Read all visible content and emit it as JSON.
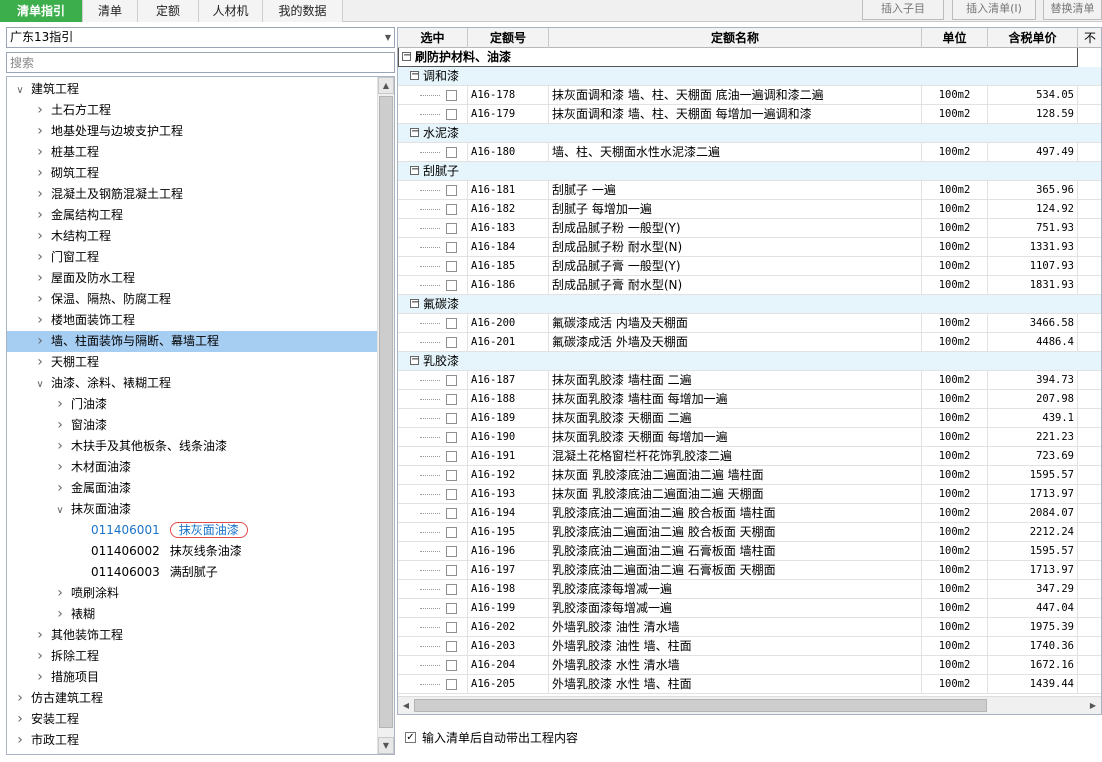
{
  "topbar": {
    "tabs": [
      {
        "label": "清单指引",
        "active": true
      },
      {
        "label": "清单",
        "active": false
      },
      {
        "label": "定额",
        "active": false
      },
      {
        "label": "人材机",
        "active": false
      },
      {
        "label": "我的数据",
        "active": false
      }
    ],
    "buttons": {
      "insert_child": "插入子目",
      "insert_list": "插入清单(I)",
      "replace_list": "替换清单"
    }
  },
  "left": {
    "guide_select": "广东13指引",
    "search_placeholder": "搜索",
    "tree": [
      {
        "label": "建筑工程",
        "level": 0,
        "toggle": "expanded"
      },
      {
        "label": "土石方工程",
        "level": 1,
        "toggle": "collapsed"
      },
      {
        "label": "地基处理与边坡支护工程",
        "level": 1,
        "toggle": "collapsed"
      },
      {
        "label": "桩基工程",
        "level": 1,
        "toggle": "collapsed"
      },
      {
        "label": "砌筑工程",
        "level": 1,
        "toggle": "collapsed"
      },
      {
        "label": "混凝土及钢筋混凝土工程",
        "level": 1,
        "toggle": "collapsed"
      },
      {
        "label": "金属结构工程",
        "level": 1,
        "toggle": "collapsed"
      },
      {
        "label": "木结构工程",
        "level": 1,
        "toggle": "collapsed"
      },
      {
        "label": "门窗工程",
        "level": 1,
        "toggle": "collapsed"
      },
      {
        "label": "屋面及防水工程",
        "level": 1,
        "toggle": "collapsed"
      },
      {
        "label": "保温、隔热、防腐工程",
        "level": 1,
        "toggle": "collapsed"
      },
      {
        "label": "楼地面装饰工程",
        "level": 1,
        "toggle": "collapsed"
      },
      {
        "label": "墙、柱面装饰与隔断、幕墙工程",
        "level": 1,
        "toggle": "collapsed",
        "selected": true
      },
      {
        "label": "天棚工程",
        "level": 1,
        "toggle": "collapsed"
      },
      {
        "label": "油漆、涂料、裱糊工程",
        "level": 1,
        "toggle": "expanded"
      },
      {
        "label": "门油漆",
        "level": 2,
        "toggle": "collapsed"
      },
      {
        "label": "窗油漆",
        "level": 2,
        "toggle": "collapsed"
      },
      {
        "label": "木扶手及其他板条、线条油漆",
        "level": 2,
        "toggle": "collapsed"
      },
      {
        "label": "木材面油漆",
        "level": 2,
        "toggle": "collapsed"
      },
      {
        "label": "金属面油漆",
        "level": 2,
        "toggle": "collapsed"
      },
      {
        "label": "抹灰面油漆",
        "level": 2,
        "toggle": "expanded"
      },
      {
        "code": "011406001",
        "label": "抹灰面油漆",
        "level": 3,
        "toggle": "none",
        "highlight": true
      },
      {
        "code": "011406002",
        "label": "抹灰线条油漆",
        "level": 3,
        "toggle": "none"
      },
      {
        "code": "011406003",
        "label": "满刮腻子",
        "level": 3,
        "toggle": "none"
      },
      {
        "label": "喷刷涂料",
        "level": 2,
        "toggle": "collapsed"
      },
      {
        "label": "裱糊",
        "level": 2,
        "toggle": "collapsed"
      },
      {
        "label": "其他装饰工程",
        "level": 1,
        "toggle": "collapsed"
      },
      {
        "label": "拆除工程",
        "level": 1,
        "toggle": "collapsed"
      },
      {
        "label": "措施项目",
        "level": 1,
        "toggle": "collapsed"
      },
      {
        "label": "仿古建筑工程",
        "level": 0,
        "toggle": "collapsed"
      },
      {
        "label": "安装工程",
        "level": 0,
        "toggle": "collapsed"
      },
      {
        "label": "市政工程",
        "level": 0,
        "toggle": "collapsed"
      }
    ]
  },
  "grid": {
    "headers": {
      "select": "选中",
      "code": "定额号",
      "name": "定额名称",
      "unit": "单位",
      "price": "含税单价",
      "extra": "不"
    },
    "rows": [
      {
        "type": "group1",
        "label": "刷防护材料、油漆"
      },
      {
        "type": "group",
        "label": "调和漆"
      },
      {
        "type": "item",
        "code": "A16-178",
        "name": "抹灰面调和漆 墙、柱、天棚面 底油一遍调和漆二遍",
        "unit": "100m2",
        "price": "534.05"
      },
      {
        "type": "item",
        "code": "A16-179",
        "name": "抹灰面调和漆 墙、柱、天棚面 每增加一遍调和漆",
        "unit": "100m2",
        "price": "128.59"
      },
      {
        "type": "group",
        "label": "水泥漆"
      },
      {
        "type": "item",
        "code": "A16-180",
        "name": "墙、柱、天棚面水性水泥漆二遍",
        "unit": "100m2",
        "price": "497.49"
      },
      {
        "type": "group",
        "label": "刮腻子"
      },
      {
        "type": "item",
        "code": "A16-181",
        "name": "刮腻子 一遍",
        "unit": "100m2",
        "price": "365.96"
      },
      {
        "type": "item",
        "code": "A16-182",
        "name": "刮腻子 每增加一遍",
        "unit": "100m2",
        "price": "124.92"
      },
      {
        "type": "item",
        "code": "A16-183",
        "name": "刮成品腻子粉 一般型(Y)",
        "unit": "100m2",
        "price": "751.93"
      },
      {
        "type": "item",
        "code": "A16-184",
        "name": "刮成品腻子粉 耐水型(N)",
        "unit": "100m2",
        "price": "1331.93"
      },
      {
        "type": "item",
        "code": "A16-185",
        "name": "刮成品腻子膏 一般型(Y)",
        "unit": "100m2",
        "price": "1107.93"
      },
      {
        "type": "item",
        "code": "A16-186",
        "name": "刮成品腻子膏 耐水型(N)",
        "unit": "100m2",
        "price": "1831.93"
      },
      {
        "type": "group",
        "label": "氟碳漆"
      },
      {
        "type": "item",
        "code": "A16-200",
        "name": "氟碳漆成活 内墙及天棚面",
        "unit": "100m2",
        "price": "3466.58"
      },
      {
        "type": "item",
        "code": "A16-201",
        "name": "氟碳漆成活 外墙及天棚面",
        "unit": "100m2",
        "price": "4486.4"
      },
      {
        "type": "group",
        "label": "乳胶漆"
      },
      {
        "type": "item",
        "code": "A16-187",
        "name": "抹灰面乳胶漆 墙柱面 二遍",
        "unit": "100m2",
        "price": "394.73"
      },
      {
        "type": "item",
        "code": "A16-188",
        "name": "抹灰面乳胶漆 墙柱面 每增加一遍",
        "unit": "100m2",
        "price": "207.98"
      },
      {
        "type": "item",
        "code": "A16-189",
        "name": "抹灰面乳胶漆 天棚面 二遍",
        "unit": "100m2",
        "price": "439.1"
      },
      {
        "type": "item",
        "code": "A16-190",
        "name": "抹灰面乳胶漆 天棚面 每增加一遍",
        "unit": "100m2",
        "price": "221.23"
      },
      {
        "type": "item",
        "code": "A16-191",
        "name": "混凝土花格窗栏杆花饰乳胶漆二遍",
        "unit": "100m2",
        "price": "723.69"
      },
      {
        "type": "item",
        "code": "A16-192",
        "name": "抹灰面 乳胶漆底油二遍面油二遍 墙柱面",
        "unit": "100m2",
        "price": "1595.57"
      },
      {
        "type": "item",
        "code": "A16-193",
        "name": "抹灰面 乳胶漆底油二遍面油二遍 天棚面",
        "unit": "100m2",
        "price": "1713.97"
      },
      {
        "type": "item",
        "code": "A16-194",
        "name": "乳胶漆底油二遍面油二遍 胶合板面 墙柱面",
        "unit": "100m2",
        "price": "2084.07"
      },
      {
        "type": "item",
        "code": "A16-195",
        "name": "乳胶漆底油二遍面油二遍 胶合板面 天棚面",
        "unit": "100m2",
        "price": "2212.24"
      },
      {
        "type": "item",
        "code": "A16-196",
        "name": "乳胶漆底油二遍面油二遍 石膏板面 墙柱面",
        "unit": "100m2",
        "price": "1595.57"
      },
      {
        "type": "item",
        "code": "A16-197",
        "name": "乳胶漆底油二遍面油二遍 石膏板面 天棚面",
        "unit": "100m2",
        "price": "1713.97"
      },
      {
        "type": "item",
        "code": "A16-198",
        "name": "乳胶漆底漆每增减一遍",
        "unit": "100m2",
        "price": "347.29"
      },
      {
        "type": "item",
        "code": "A16-199",
        "name": "乳胶漆面漆每增减一遍",
        "unit": "100m2",
        "price": "447.04"
      },
      {
        "type": "item",
        "code": "A16-202",
        "name": "外墙乳胶漆 油性 清水墙",
        "unit": "100m2",
        "price": "1975.39"
      },
      {
        "type": "item",
        "code": "A16-203",
        "name": "外墙乳胶漆 油性 墙、柱面",
        "unit": "100m2",
        "price": "1740.36"
      },
      {
        "type": "item",
        "code": "A16-204",
        "name": "外墙乳胶漆 水性 清水墙",
        "unit": "100m2",
        "price": "1672.16"
      },
      {
        "type": "item",
        "code": "A16-205",
        "name": "外墙乳胶漆 水性 墙、柱面",
        "unit": "100m2",
        "price": "1439.44"
      }
    ]
  },
  "footer": {
    "auto_bring_label": "输入清单后自动带出工程内容",
    "auto_bring_checked": true
  },
  "colors": {
    "active_tab": "#3cae4c",
    "selection": "#a6cdf2",
    "group_row": "#e6f5fb",
    "link_blue": "#1a74c9",
    "highlight_ring": "#e24b4b"
  }
}
